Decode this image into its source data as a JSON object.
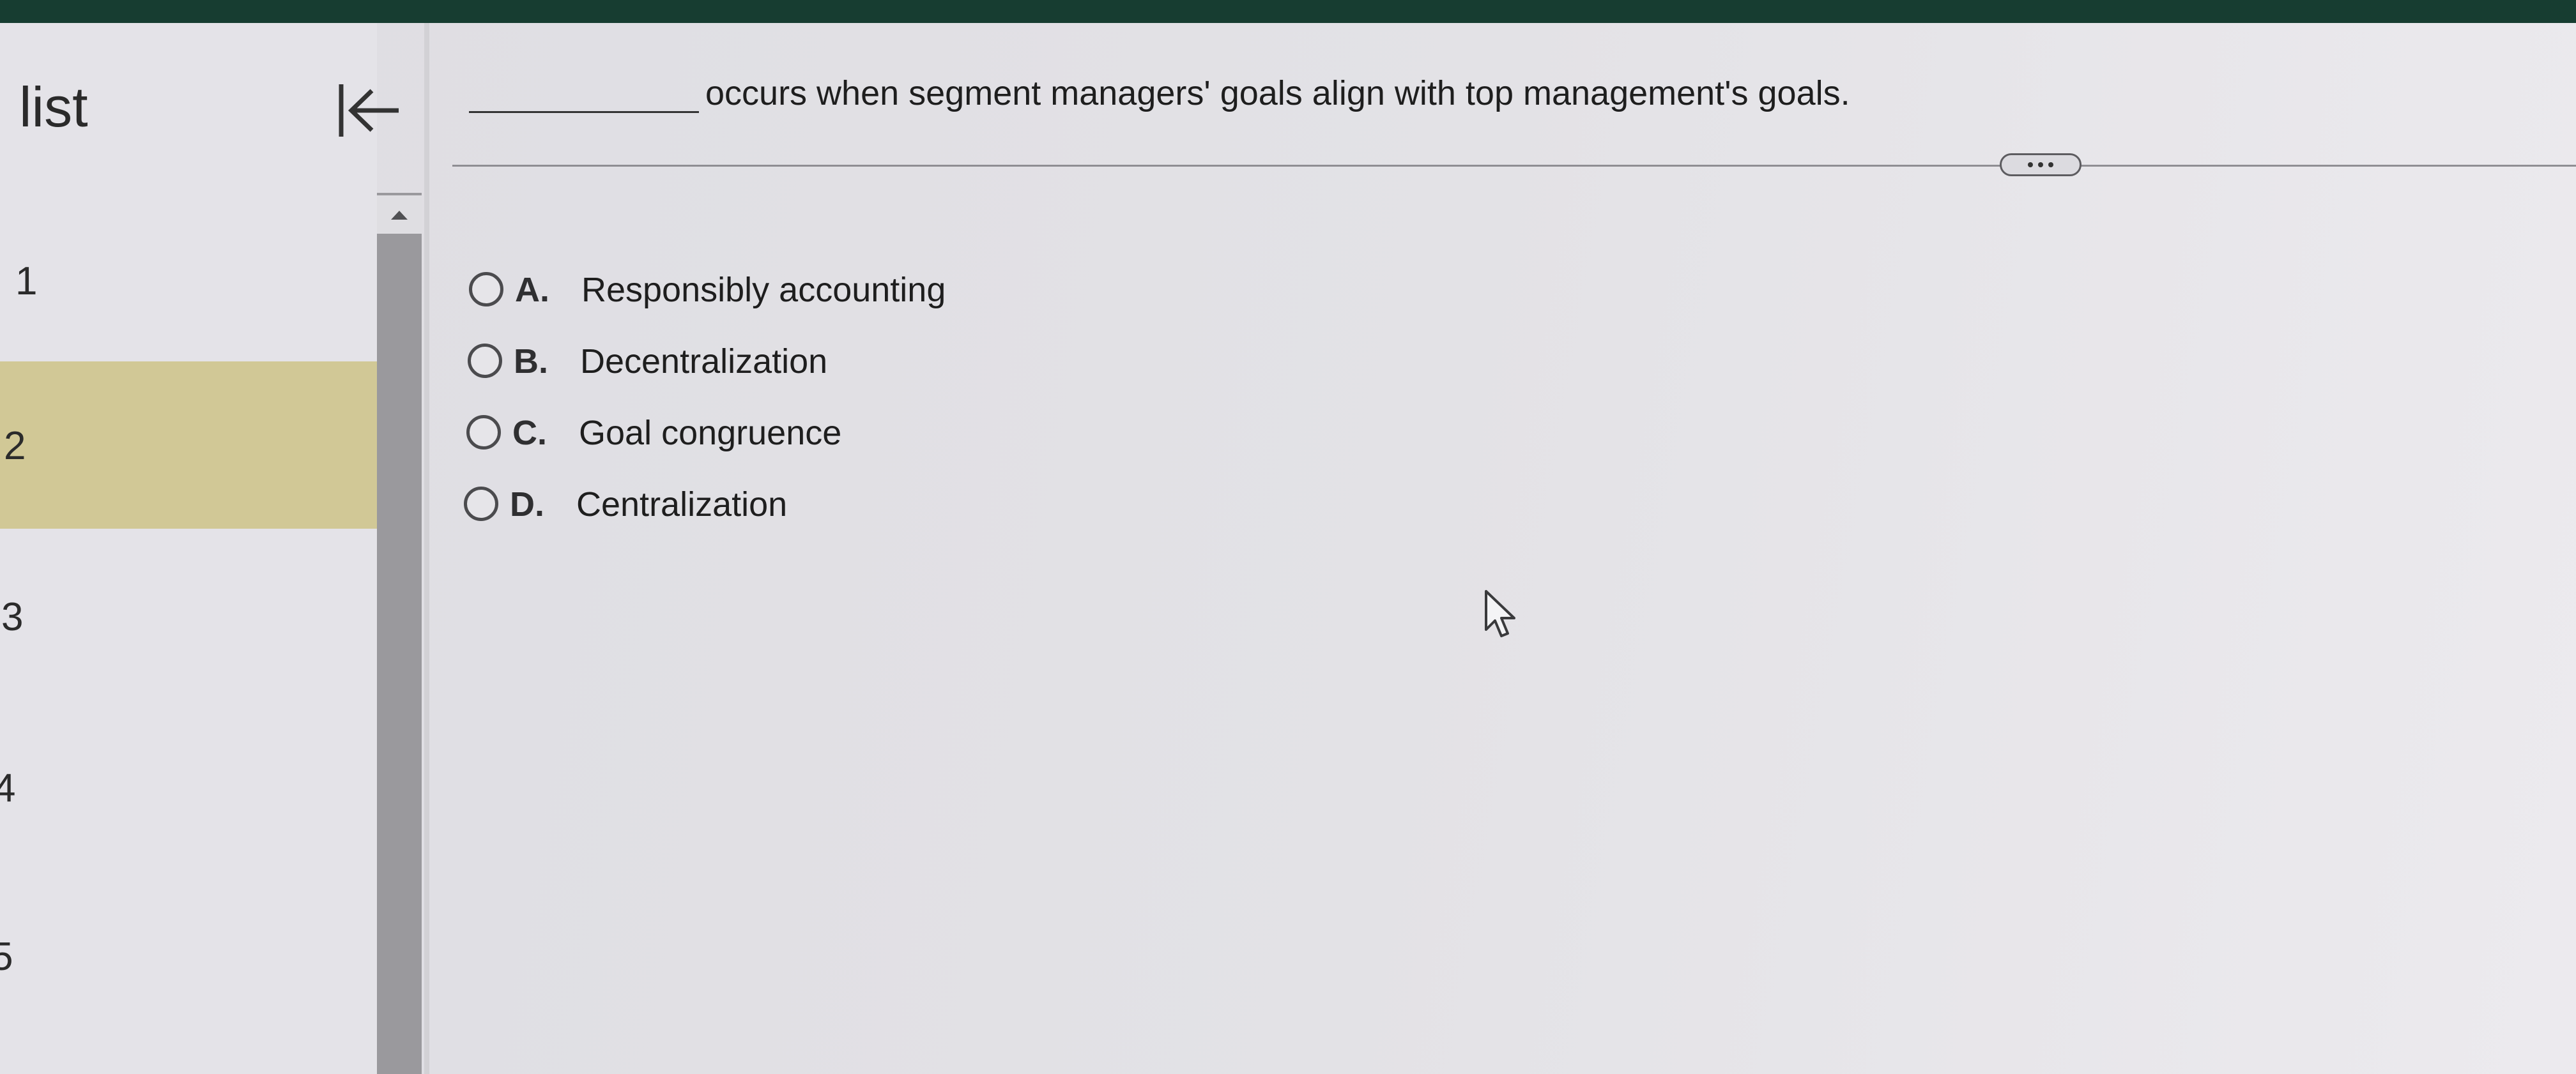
{
  "sidebar": {
    "title": "list",
    "collapse_icon": "collapse-left-icon",
    "items": [
      {
        "number": "1"
      },
      {
        "number": "2"
      },
      {
        "number": "3"
      },
      {
        "number": "4"
      },
      {
        "number": "5"
      }
    ],
    "selected_index": 1,
    "selected_color": "#d1c896"
  },
  "question": {
    "text": "occurs when segment managers' goals align with top management's goals.",
    "more_icon": "ellipsis-icon",
    "options": [
      {
        "letter": "A.",
        "text": "Responsibly accounting"
      },
      {
        "letter": "B.",
        "text": "Decentralization"
      },
      {
        "letter": "C.",
        "text": "Goal congruence"
      },
      {
        "letter": "D.",
        "text": "Centralization"
      }
    ]
  },
  "colors": {
    "top_bar": "#173d31",
    "background": "#e2e1e4"
  }
}
